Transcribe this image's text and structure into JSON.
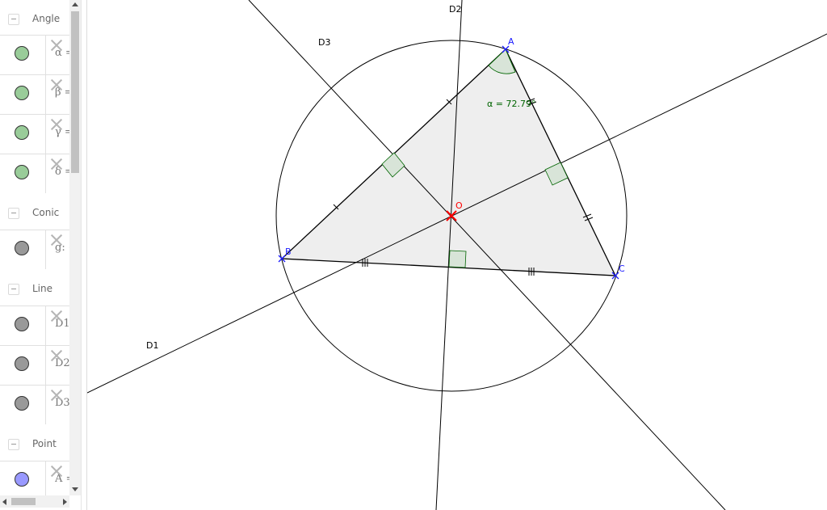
{
  "algebra": {
    "groups": [
      {
        "label": "Angle",
        "items": [
          {
            "text": "α =",
            "color": "#99cc99"
          },
          {
            "text": "β =",
            "color": "#99cc99"
          },
          {
            "text": "γ =",
            "color": "#99cc99"
          },
          {
            "text": "δ =",
            "color": "#99cc99"
          }
        ]
      },
      {
        "label": "Conic",
        "items": [
          {
            "text": "g: (",
            "color": "#999999"
          }
        ]
      },
      {
        "label": "Line",
        "items": [
          {
            "text": "D1",
            "color": "#999999"
          },
          {
            "text": "D2",
            "color": "#999999"
          },
          {
            "text": "D3",
            "color": "#999999"
          }
        ]
      },
      {
        "label": "Point",
        "items": [
          {
            "text": "A =",
            "color": "#9999ff"
          }
        ]
      }
    ]
  },
  "graphics": {
    "lines": {
      "D1": "D1",
      "D2": "D2",
      "D3": "D3"
    },
    "points": {
      "A": "A",
      "B": "B",
      "C": "C",
      "O": "O"
    },
    "angle_label": "α = 72.79°",
    "colors": {
      "points": "#1a1aff",
      "center": "#ff0000",
      "angle": "#006400",
      "triangle_fill": "#eeeeee",
      "lines": "#000000"
    }
  }
}
